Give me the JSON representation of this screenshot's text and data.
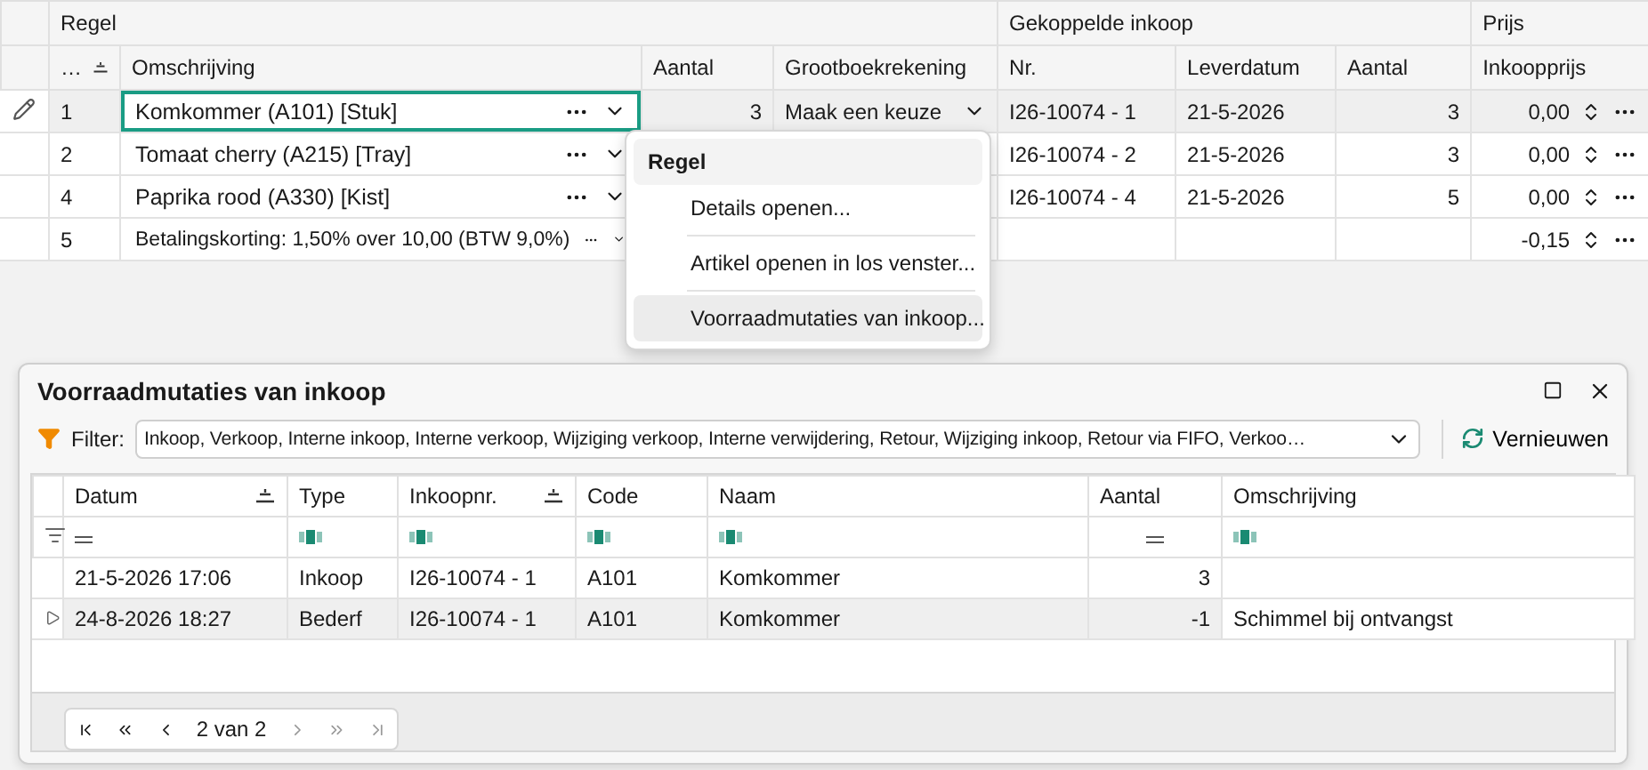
{
  "lines_grid": {
    "column_groups": [
      "Regel",
      "Gekoppelde inkoop",
      "Prijs"
    ],
    "columns": [
      {
        "label": "…",
        "sorted": true
      },
      {
        "label": "Omschrijving",
        "sorted": false
      },
      {
        "label": "Aantal",
        "sorted": false
      },
      {
        "label": "Grootboekrekening",
        "sorted": false
      },
      {
        "label": "Nr.",
        "sorted": false
      },
      {
        "label": "Leverdatum",
        "sorted": false
      },
      {
        "label": "Aantal",
        "sorted": false
      },
      {
        "label": "Inkoopprijs",
        "sorted": false
      }
    ],
    "rows": [
      {
        "nr": "1",
        "omschrijving": "Komkommer (A101) [Stuk]",
        "aantal": "3",
        "grootboek": "Maak een keuze",
        "inkoop_nr": "I26-10074 - 1",
        "leverdatum": "21-5-2026",
        "inkoop_aantal": "3",
        "inkoopprijs": "0,00",
        "selected": true
      },
      {
        "nr": "2",
        "omschrijving": "Tomaat cherry (A215) [Tray]",
        "inkoop_nr": "I26-10074 - 2",
        "leverdatum": "21-5-2026",
        "inkoop_aantal": "3",
        "inkoopprijs": "0,00",
        "selected": false
      },
      {
        "nr": "4",
        "omschrijving": "Paprika rood (A330) [Kist]",
        "inkoop_nr": "I26-10074 - 4",
        "leverdatum": "21-5-2026",
        "inkoop_aantal": "5",
        "inkoopprijs": "0,00",
        "selected": false
      },
      {
        "nr": "5",
        "omschrijving": "Betalingskorting: 1,50% over 10,00 (BTW 9,0%)",
        "inkoopprijs": "-0,15",
        "selected": false
      }
    ]
  },
  "context_menu": {
    "title": "Regel",
    "items": [
      {
        "label": "Details openen...",
        "highlighted": false
      },
      {
        "label": "Artikel openen in los venster...",
        "highlighted": false
      },
      {
        "label": "Voorraadmutaties van inkoop...",
        "highlighted": true
      }
    ]
  },
  "dialog": {
    "title": "Voorraadmutaties van inkoop",
    "filter_label": "Filter:",
    "filter_value": "Inkoop, Verkoop, Interne inkoop, Interne verkoop, Wijziging verkoop, Interne verwijdering, Retour, Wijziging inkoop, Retour via FIFO, Verkoo…",
    "refresh_button": "Vernieuwen",
    "columns": [
      {
        "label": "Datum",
        "sorted": true,
        "kind": "equals"
      },
      {
        "label": "Type",
        "sorted": false,
        "kind": "text"
      },
      {
        "label": "Inkoopnr.",
        "sorted": true,
        "kind": "text"
      },
      {
        "label": "Code",
        "sorted": false,
        "kind": "text"
      },
      {
        "label": "Naam",
        "sorted": false,
        "kind": "text"
      },
      {
        "label": "Aantal",
        "sorted": false,
        "kind": "equals"
      },
      {
        "label": "Omschrijving",
        "sorted": false,
        "kind": "text"
      }
    ],
    "rows": [
      {
        "cells": [
          "21-5-2026 17:06",
          "Inkoop",
          "I26-10074 - 1",
          "A101",
          "Komkommer",
          "3",
          ""
        ],
        "selected": false
      },
      {
        "cells": [
          "24-8-2026 18:27",
          "Bederf",
          "I26-10074 - 1",
          "A101",
          "Komkommer",
          "-1",
          "Schimmel bij ontvangst"
        ],
        "selected": true
      }
    ],
    "pager": "2 van 2"
  }
}
